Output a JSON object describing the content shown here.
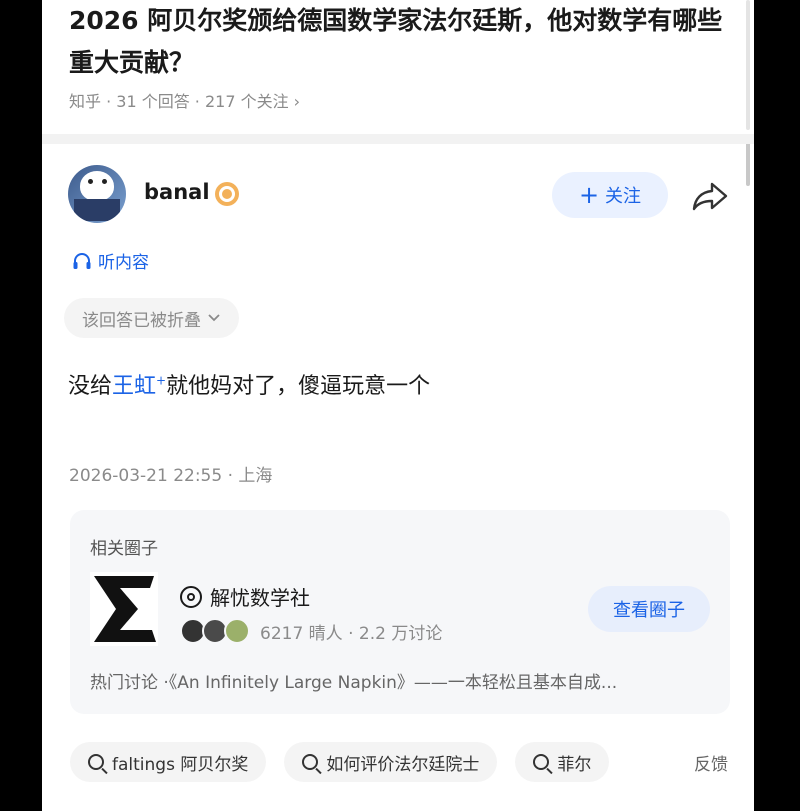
{
  "question": {
    "title": "2026 阿贝尔奖颁给德国数学家法尔廷斯，他对数学有哪些重大贡献？",
    "meta": "知乎 · 31 个回答 · 217 个关注 ›"
  },
  "author": {
    "name": "banal",
    "follow_label": "关注",
    "follow_icon": "plus-icon",
    "share_icon": "share-icon"
  },
  "listen_label": "听内容",
  "folded_label": "该回答已被折叠",
  "answer": {
    "prefix": "没给",
    "link": "王虹",
    "link_mark": "+",
    "suffix": "就他妈对了，傻逼玩意一个"
  },
  "timestamp": "2026-03-21 22:55 · 上海",
  "circle": {
    "heading": "相关圈子",
    "name": "解忧数学社",
    "stats": "6217 晴人 · 2.2 万讨论",
    "view_label": "查看圈子",
    "hot": "热门讨论 ·《An Infinitely Large Napkin》——一本轻松且基本自成..."
  },
  "search_chips": [
    {
      "label": "faltings 阿贝尔奖"
    },
    {
      "label": "如何评价法尔廷院士"
    },
    {
      "label": "菲尔"
    }
  ],
  "feedback_label": "反馈",
  "colors": {
    "accent": "#1b63e6",
    "muted": "#8a8a8a"
  }
}
